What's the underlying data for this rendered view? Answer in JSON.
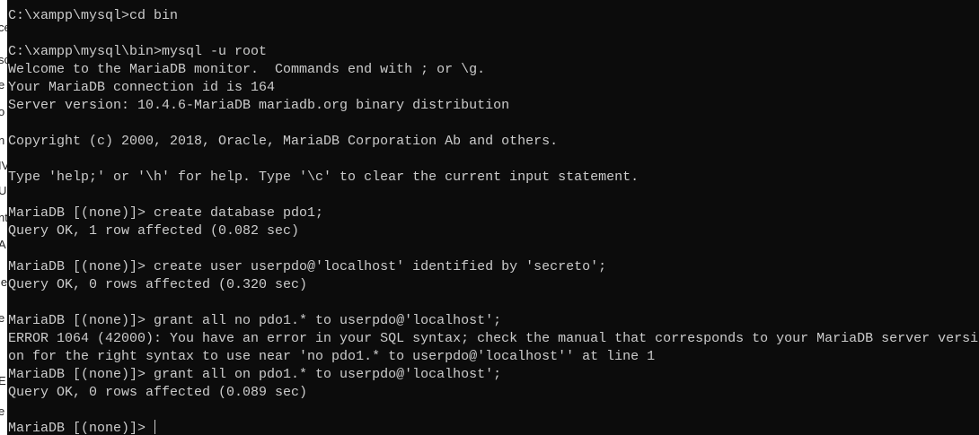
{
  "left_strip": [
    "ce",
    "sc",
    "e",
    "o",
    "n",
    "IV",
    "UE",
    "nt",
    "A",
    "le",
    "e",
    "E",
    "e"
  ],
  "console": {
    "lines": [
      "C:\\xampp\\mysql>cd bin",
      "",
      "C:\\xampp\\mysql\\bin>mysql -u root",
      "Welcome to the MariaDB monitor.  Commands end with ; or \\g.",
      "Your MariaDB connection id is 164",
      "Server version: 10.4.6-MariaDB mariadb.org binary distribution",
      "",
      "Copyright (c) 2000, 2018, Oracle, MariaDB Corporation Ab and others.",
      "",
      "Type 'help;' or '\\h' for help. Type '\\c' to clear the current input statement.",
      "",
      "MariaDB [(none)]> create database pdo1;",
      "Query OK, 1 row affected (0.082 sec)",
      "",
      "MariaDB [(none)]> create user userpdo@'localhost' identified by 'secreto';",
      "Query OK, 0 rows affected (0.320 sec)",
      "",
      "MariaDB [(none)]> grant all no pdo1.* to userpdo@'localhost';",
      "ERROR 1064 (42000): You have an error in your SQL syntax; check the manual that corresponds to your MariaDB server versi",
      "on for the right syntax to use near 'no pdo1.* to userpdo@'localhost'' at line 1",
      "MariaDB [(none)]> grant all on pdo1.* to userpdo@'localhost';",
      "Query OK, 0 rows affected (0.089 sec)",
      "",
      "MariaDB [(none)]> "
    ]
  }
}
